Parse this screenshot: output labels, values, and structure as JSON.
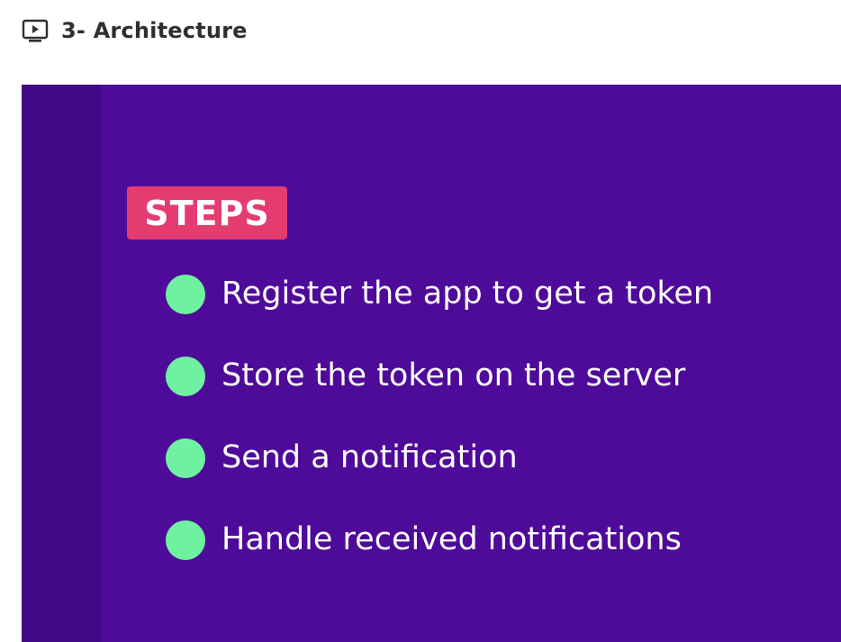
{
  "header": {
    "icon": "video-play-icon",
    "title": "3- Architecture"
  },
  "slide": {
    "badge": "STEPS",
    "steps": [
      "Register the app to get a token",
      "Store the token on the server",
      "Send a notification",
      "Handle received notifications"
    ],
    "colors": {
      "background": "#4e0b9a",
      "side_band": "#430a87",
      "badge": "#e43b70",
      "bullet": "#6ff2a0",
      "text": "#ffffff"
    }
  }
}
